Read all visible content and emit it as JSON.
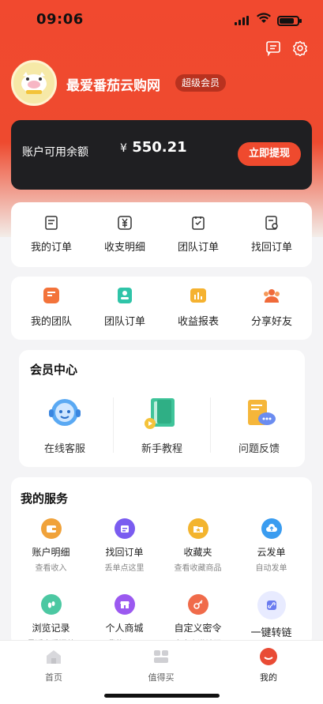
{
  "status": {
    "time": "09:06"
  },
  "profile": {
    "username": "最爱番茄云购网",
    "badge": "超级会员"
  },
  "balance": {
    "label": "账户可用余额",
    "currency": "¥",
    "amount": "550.21",
    "withdraw_label": "立即提现"
  },
  "orders": [
    {
      "label": "我的订单",
      "icon": "list-icon"
    },
    {
      "label": "收支明细",
      "icon": "yuan-icon"
    },
    {
      "label": "团队订单",
      "icon": "check-icon"
    },
    {
      "label": "找回订单",
      "icon": "find-icon"
    }
  ],
  "team": [
    {
      "label": "我的团队",
      "icon": "team-icon"
    },
    {
      "label": "团队订单",
      "icon": "team-order-icon"
    },
    {
      "label": "收益报表",
      "icon": "report-icon"
    },
    {
      "label": "分享好友",
      "icon": "share-icon"
    }
  ],
  "member": {
    "title": "会员中心",
    "items": [
      {
        "label": "在线客服",
        "icon": "customer-service-icon"
      },
      {
        "label": "新手教程",
        "icon": "tutorial-icon"
      },
      {
        "label": "问题反馈",
        "icon": "feedback-icon"
      }
    ]
  },
  "services": {
    "title": "我的服务",
    "items": [
      {
        "label": "账户明细",
        "sub": "查看收入",
        "icon": "wallet-icon",
        "color": "#f0a23a"
      },
      {
        "label": "找回订单",
        "sub": "丢单点这里",
        "icon": "calendar-icon",
        "color": "#7a5cf0"
      },
      {
        "label": "收藏夹",
        "sub": "查看收藏商品",
        "icon": "folder-icon",
        "color": "#f3b42e"
      },
      {
        "label": "云发单",
        "sub": "自动发单",
        "icon": "cloud-icon",
        "color": "#3a9cf0"
      },
      {
        "label": "浏览记录",
        "sub": "最近查看汇总",
        "icon": "footprint-icon",
        "color": "#4cc8a2"
      },
      {
        "label": "个人商城",
        "sub": "我的CMS",
        "icon": "store-icon",
        "color": "#9b59f0"
      },
      {
        "label": "自定义密令",
        "sub": "自定义邀请码",
        "icon": "key-icon",
        "color": "#f06b4a"
      },
      {
        "label": "一键转链",
        "sub": "",
        "icon": "link-icon",
        "color": "#6b7cf0"
      }
    ]
  },
  "tabs": [
    {
      "label": "首页",
      "icon": "home-icon"
    },
    {
      "label": "值得买",
      "icon": "worth-icon"
    },
    {
      "label": "我的",
      "icon": "me-icon"
    }
  ],
  "colors": {
    "brand": "#ee4a2f",
    "card_dark": "#1f1f22"
  }
}
